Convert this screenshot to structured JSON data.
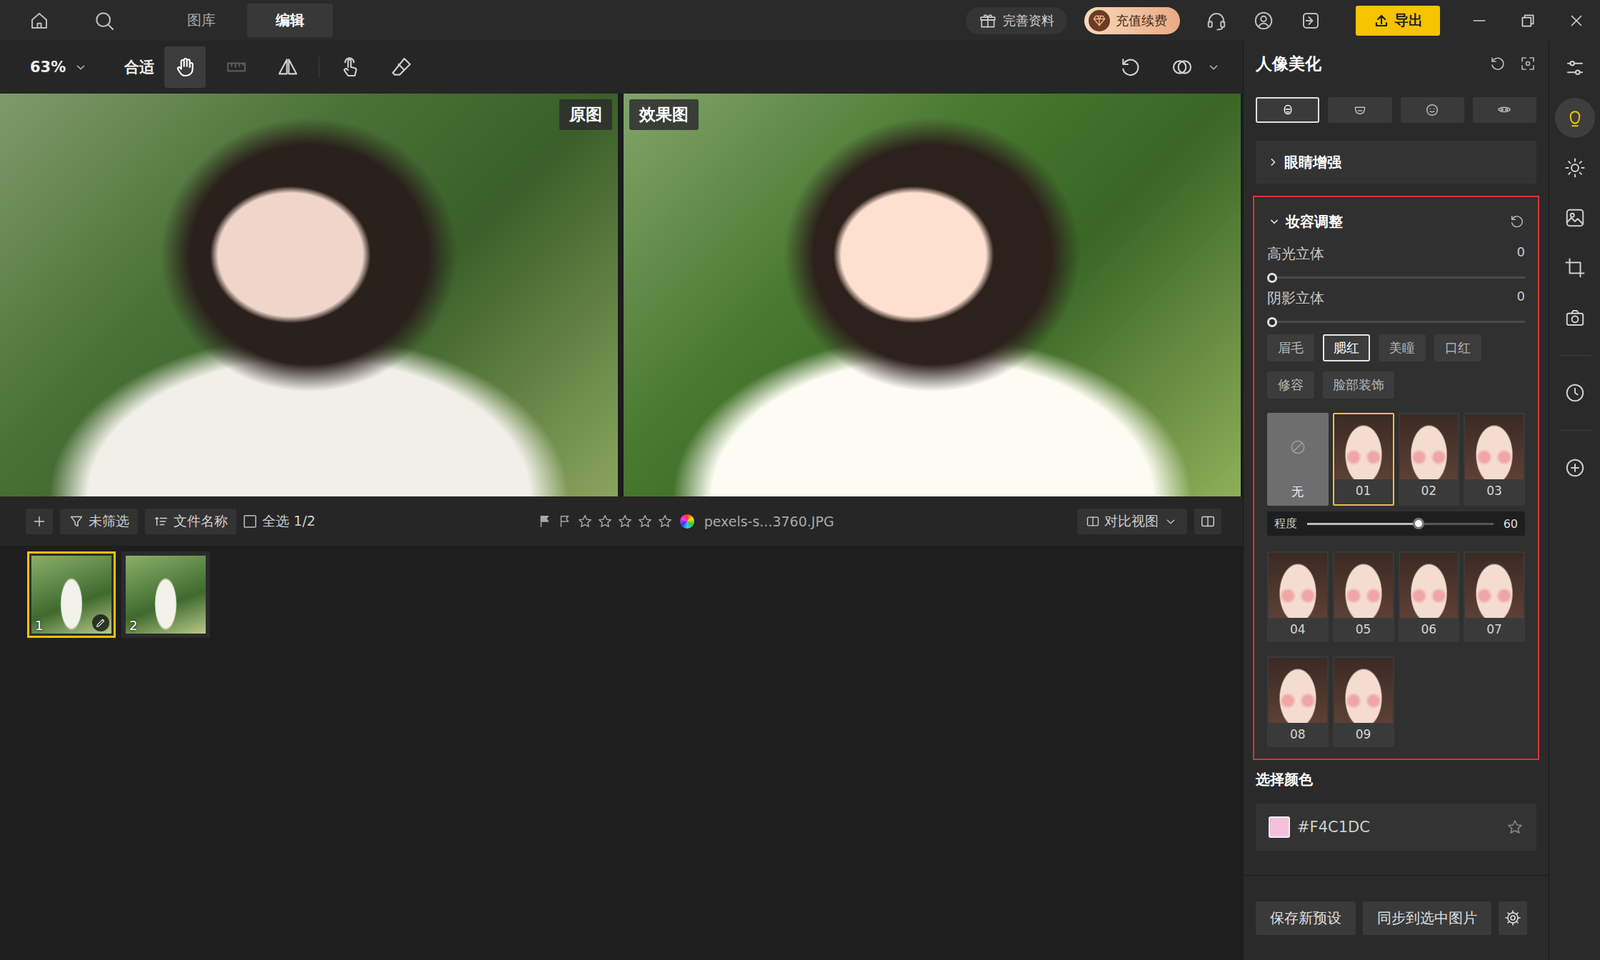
{
  "topbar": {
    "tabs": [
      {
        "label": "图库",
        "selected": false
      },
      {
        "label": "编辑",
        "selected": true
      }
    ],
    "profile_button": "完善资料",
    "vip_button": "充值续费",
    "export_button": "导出"
  },
  "toolbar": {
    "zoom": "63%",
    "fit": "合适",
    "tools": [
      {
        "kind": "hand",
        "selected": true,
        "disabled": false
      },
      {
        "kind": "ruler",
        "selected": false,
        "disabled": true
      },
      {
        "kind": "flip",
        "selected": false,
        "disabled": false
      },
      {
        "kind": "touch",
        "selected": false,
        "disabled": false
      },
      {
        "kind": "eraser",
        "selected": false,
        "disabled": false
      }
    ]
  },
  "canvas": {
    "original_label": "原图",
    "result_label": "效果图"
  },
  "filmstrip": {
    "filter": "未筛选",
    "sort": "文件名称",
    "select_all": {
      "label": "全选 1/2",
      "checked": false
    },
    "stars": 0,
    "filename": "pexels-s...3760.JPG",
    "view_mode": "对比视图",
    "thumbnails": [
      {
        "number": "1",
        "selected": true,
        "edited": true
      },
      {
        "number": "2",
        "selected": false,
        "edited": false
      }
    ]
  },
  "panel": {
    "title": "人像美化",
    "tabs": [
      {
        "kind": "face-outline",
        "selected": true
      },
      {
        "kind": "chin",
        "selected": false
      },
      {
        "kind": "smile",
        "selected": false
      },
      {
        "kind": "mask",
        "selected": false
      }
    ],
    "eye": {
      "label": "眼睛增强",
      "expanded": false
    },
    "makeup": {
      "label": "妆容调整",
      "expanded": true,
      "sliders": [
        {
          "label": "高光立体",
          "value": "0",
          "level": 0
        },
        {
          "label": "阴影立体",
          "value": "0",
          "level": 0
        }
      ],
      "categories": [
        {
          "label": "眉毛",
          "selected": false
        },
        {
          "label": "腮红",
          "selected": true
        },
        {
          "label": "美瞳",
          "selected": false
        },
        {
          "label": "口红",
          "selected": false
        },
        {
          "label": "修容",
          "selected": false
        },
        {
          "label": "脸部装饰",
          "selected": false
        }
      ],
      "presets": [
        {
          "label": "无",
          "kind": "none",
          "selected": false
        },
        {
          "label": "01",
          "kind": "face",
          "selected": true
        },
        {
          "label": "02",
          "kind": "face",
          "selected": false
        },
        {
          "label": "03",
          "kind": "face",
          "selected": false
        },
        {
          "label": "04",
          "kind": "face",
          "selected": false
        },
        {
          "label": "05",
          "kind": "face",
          "selected": false
        },
        {
          "label": "06",
          "kind": "face",
          "selected": false
        },
        {
          "label": "07",
          "kind": "face",
          "selected": false
        },
        {
          "label": "08",
          "kind": "face",
          "selected": false
        },
        {
          "label": "09",
          "kind": "face",
          "selected": false
        }
      ],
      "intensity": {
        "label": "程度",
        "value": "60",
        "level": 0.6
      }
    },
    "color": {
      "label": "选择颜色",
      "value": "#F4C1DC",
      "favorite": false
    },
    "footer": {
      "save": "保存新预设",
      "sync": "同步到选中图片"
    }
  },
  "rail": {
    "items": [
      {
        "kind": "sliders",
        "selected": false
      },
      {
        "kind": "face",
        "selected": true
      },
      {
        "kind": "sun",
        "selected": false
      },
      {
        "kind": "image-edit",
        "selected": false
      },
      {
        "kind": "crop",
        "selected": false
      },
      {
        "kind": "camera",
        "selected": false
      },
      {
        "kind": "clock",
        "selected": false
      },
      {
        "kind": "plus-circle",
        "selected": false
      }
    ]
  }
}
